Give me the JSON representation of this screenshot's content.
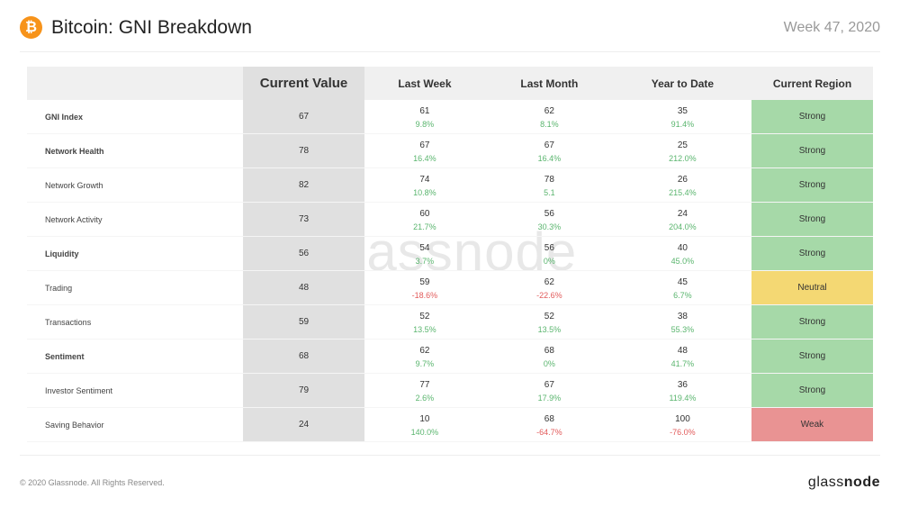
{
  "header": {
    "title": "Bitcoin: GNI Breakdown",
    "week": "Week 47, 2020",
    "icon": "₿"
  },
  "cols": {
    "metric": "",
    "cv": "Current Value",
    "lw": "Last Week",
    "lm": "Last Month",
    "ytd": "Year to Date",
    "reg": "Current Region"
  },
  "rows": [
    {
      "m": "GNI Index",
      "b": true,
      "cv": "67",
      "lw": {
        "v": "61",
        "d": "9.8%",
        "s": "pos"
      },
      "lm": {
        "v": "62",
        "d": "8.1%",
        "s": "pos"
      },
      "ytd": {
        "v": "35",
        "d": "91.4%",
        "s": "pos"
      },
      "reg": "Strong",
      "rc": "strong"
    },
    {
      "m": "Network Health",
      "b": true,
      "cv": "78",
      "lw": {
        "v": "67",
        "d": "16.4%",
        "s": "pos"
      },
      "lm": {
        "v": "67",
        "d": "16.4%",
        "s": "pos"
      },
      "ytd": {
        "v": "25",
        "d": "212.0%",
        "s": "pos"
      },
      "reg": "Strong",
      "rc": "strong"
    },
    {
      "m": "Network Growth",
      "b": false,
      "cv": "82",
      "lw": {
        "v": "74",
        "d": "10.8%",
        "s": "pos"
      },
      "lm": {
        "v": "78",
        "d": "5.1",
        "s": "pos"
      },
      "ytd": {
        "v": "26",
        "d": "215.4%",
        "s": "pos"
      },
      "reg": "Strong",
      "rc": "strong"
    },
    {
      "m": "Network Activity",
      "b": false,
      "cv": "73",
      "lw": {
        "v": "60",
        "d": "21.7%",
        "s": "pos"
      },
      "lm": {
        "v": "56",
        "d": "30.3%",
        "s": "pos"
      },
      "ytd": {
        "v": "24",
        "d": "204.0%",
        "s": "pos"
      },
      "reg": "Strong",
      "rc": "strong"
    },
    {
      "m": "Liquidity",
      "b": true,
      "cv": "56",
      "lw": {
        "v": "54",
        "d": "3.7%",
        "s": "pos"
      },
      "lm": {
        "v": "56",
        "d": "0%",
        "s": "pos"
      },
      "ytd": {
        "v": "40",
        "d": "45.0%",
        "s": "pos"
      },
      "reg": "Strong",
      "rc": "strong"
    },
    {
      "m": "Trading",
      "b": false,
      "cv": "48",
      "lw": {
        "v": "59",
        "d": "-18.6%",
        "s": "neg"
      },
      "lm": {
        "v": "62",
        "d": "-22.6%",
        "s": "neg"
      },
      "ytd": {
        "v": "45",
        "d": "6.7%",
        "s": "pos"
      },
      "reg": "Neutral",
      "rc": "neutral"
    },
    {
      "m": "Transactions",
      "b": false,
      "cv": "59",
      "lw": {
        "v": "52",
        "d": "13.5%",
        "s": "pos"
      },
      "lm": {
        "v": "52",
        "d": "13.5%",
        "s": "pos"
      },
      "ytd": {
        "v": "38",
        "d": "55.3%",
        "s": "pos"
      },
      "reg": "Strong",
      "rc": "strong"
    },
    {
      "m": "Sentiment",
      "b": true,
      "cv": "68",
      "lw": {
        "v": "62",
        "d": "9.7%",
        "s": "pos"
      },
      "lm": {
        "v": "68",
        "d": "0%",
        "s": "pos"
      },
      "ytd": {
        "v": "48",
        "d": "41.7%",
        "s": "pos"
      },
      "reg": "Strong",
      "rc": "strong"
    },
    {
      "m": "Investor Sentiment",
      "b": false,
      "cv": "79",
      "lw": {
        "v": "77",
        "d": "2.6%",
        "s": "pos"
      },
      "lm": {
        "v": "67",
        "d": "17.9%",
        "s": "pos"
      },
      "ytd": {
        "v": "36",
        "d": "119.4%",
        "s": "pos"
      },
      "reg": "Strong",
      "rc": "strong"
    },
    {
      "m": "Saving Behavior",
      "b": false,
      "cv": "24",
      "lw": {
        "v": "10",
        "d": "140.0%",
        "s": "pos"
      },
      "lm": {
        "v": "68",
        "d": "-64.7%",
        "s": "neg"
      },
      "ytd": {
        "v": "100",
        "d": "-76.0%",
        "s": "neg"
      },
      "reg": "Weak",
      "rc": "weak"
    }
  ],
  "footer": {
    "copy": "© 2020 Glassnode. All Rights Reserved.",
    "brand1": "glass",
    "brand2": "node"
  },
  "watermark": "glassnode"
}
